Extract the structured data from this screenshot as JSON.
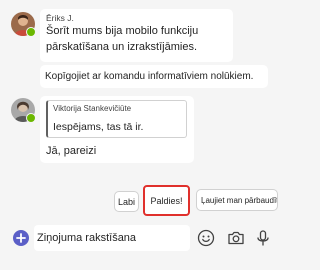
{
  "messages": [
    {
      "sender": "Ēriks J.",
      "lines": [
        "Šorīt mums bija mobilo funkciju",
        "pārskatīšana un izrakstījāmies."
      ],
      "followup": "Kopīgojiet ar komandu informatīviem nolūkiem."
    },
    {
      "quote_author": "Viktorija Stankevičiūte",
      "quote_text": "Iespējams, tas tā ir.",
      "text": "Jā, pareizi"
    }
  ],
  "suggested_replies": [
    "Labi",
    "Paldies!",
    "Ļaujiet man pārbaudīt"
  ],
  "compose": {
    "placeholder": "Ziņojuma rakstīšana"
  },
  "icons": {
    "add": "plus-circle-icon",
    "emoji": "emoji-icon",
    "camera": "camera-icon",
    "mic": "microphone-icon"
  },
  "colors": {
    "accent": "#5b5fc7",
    "presence": "#6bb700",
    "selection": "#e0302c"
  }
}
